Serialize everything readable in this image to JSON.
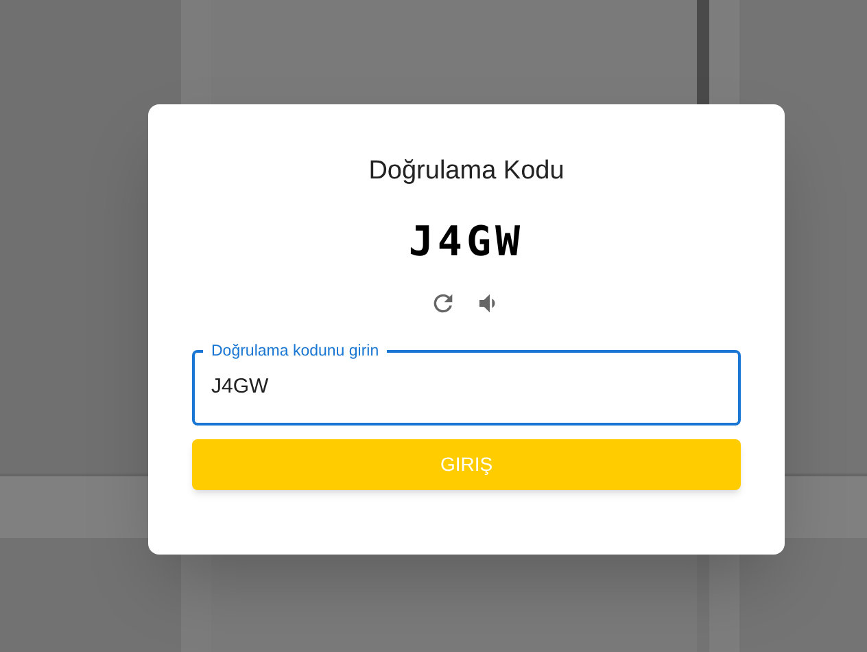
{
  "dialog": {
    "title": "Doğrulama Kodu",
    "captcha_code": "J4GW",
    "field": {
      "label": "Doğrulama kodunu girin",
      "value": "J4GW",
      "focused": true
    },
    "submit_button": {
      "label": "GIRIŞ"
    }
  }
}
